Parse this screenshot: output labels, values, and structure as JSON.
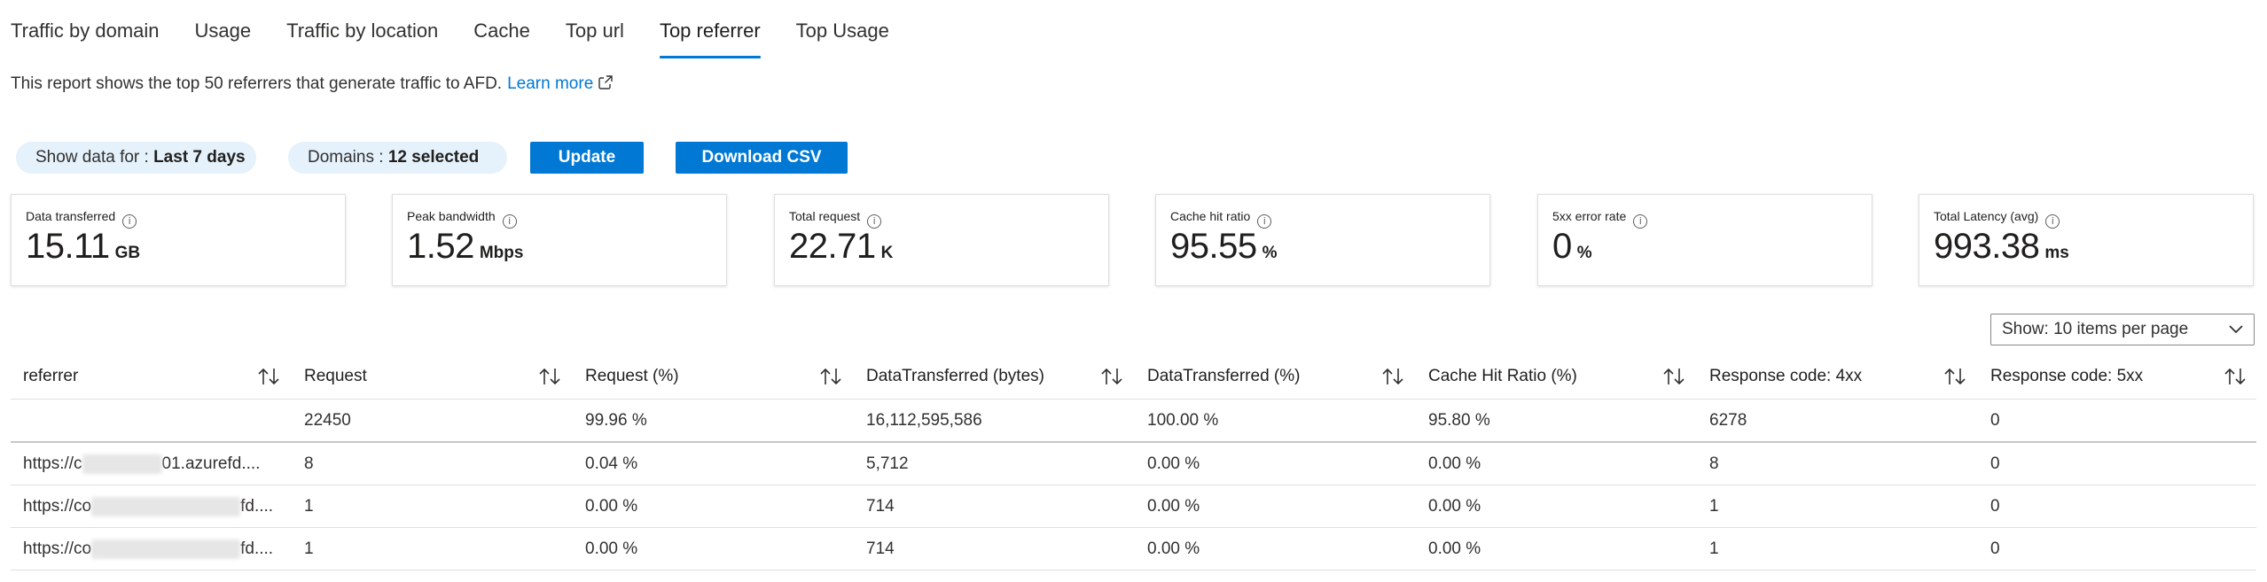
{
  "tabs": [
    {
      "label": "Traffic by domain"
    },
    {
      "label": "Usage"
    },
    {
      "label": "Traffic by location"
    },
    {
      "label": "Cache"
    },
    {
      "label": "Top url"
    },
    {
      "label": "Top referrer",
      "active": true
    },
    {
      "label": "Top Usage"
    }
  ],
  "description": {
    "text": "This report shows the top 50 referrers that generate traffic to AFD.",
    "link": "Learn more"
  },
  "controls": {
    "show_data_prefix": "Show data for : ",
    "show_data_value": "Last 7 days",
    "domains_prefix": "Domains : ",
    "domains_value": "12 selected",
    "update_label": "Update",
    "download_label": "Download CSV"
  },
  "metrics": [
    {
      "label": "Data transferred",
      "value": "15.11",
      "unit": "GB"
    },
    {
      "label": "Peak bandwidth",
      "value": "1.52",
      "unit": "Mbps"
    },
    {
      "label": "Total request",
      "value": "22.71",
      "unit": "K"
    },
    {
      "label": "Cache hit ratio",
      "value": "95.55",
      "unit": "%"
    },
    {
      "label": "5xx error rate",
      "value": "0",
      "unit": "%"
    },
    {
      "label": "Total Latency (avg)",
      "value": "993.38",
      "unit": "ms"
    }
  ],
  "page_size": {
    "label": "Show: 10 items per page"
  },
  "table": {
    "columns": [
      "referrer",
      "Request",
      "Request (%)",
      "DataTransferred (bytes)",
      "DataTransferred (%)",
      "Cache Hit Ratio (%)",
      "Response code: 4xx",
      "Response code: 5xx"
    ],
    "total": [
      "",
      "22450",
      "99.96 %",
      "16,112,595,586",
      "100.00 %",
      "95.80 %",
      "6278",
      "0"
    ],
    "rows": [
      {
        "ref_start": "https://c",
        "ref_end": "01.azurefd....",
        "cells": [
          "8",
          "0.04 %",
          "5,712",
          "0.00 %",
          "0.00 %",
          "8",
          "0"
        ]
      },
      {
        "ref_start": "https://co",
        "ref_end": "fd....",
        "cells": [
          "1",
          "0.00 %",
          "714",
          "0.00 %",
          "0.00 %",
          "1",
          "0"
        ]
      },
      {
        "ref_start": "https://co",
        "ref_end": "fd....",
        "cells": [
          "1",
          "0.00 %",
          "714",
          "0.00 %",
          "0.00 %",
          "1",
          "0"
        ]
      }
    ]
  },
  "colors": {
    "accent": "#0078d4",
    "pill_bg": "#e5f1fb"
  },
  "icons": {
    "external": "external-link-icon",
    "info": "info-icon",
    "sort": "sort-arrows-icon",
    "chevron": "chevron-down-icon"
  }
}
